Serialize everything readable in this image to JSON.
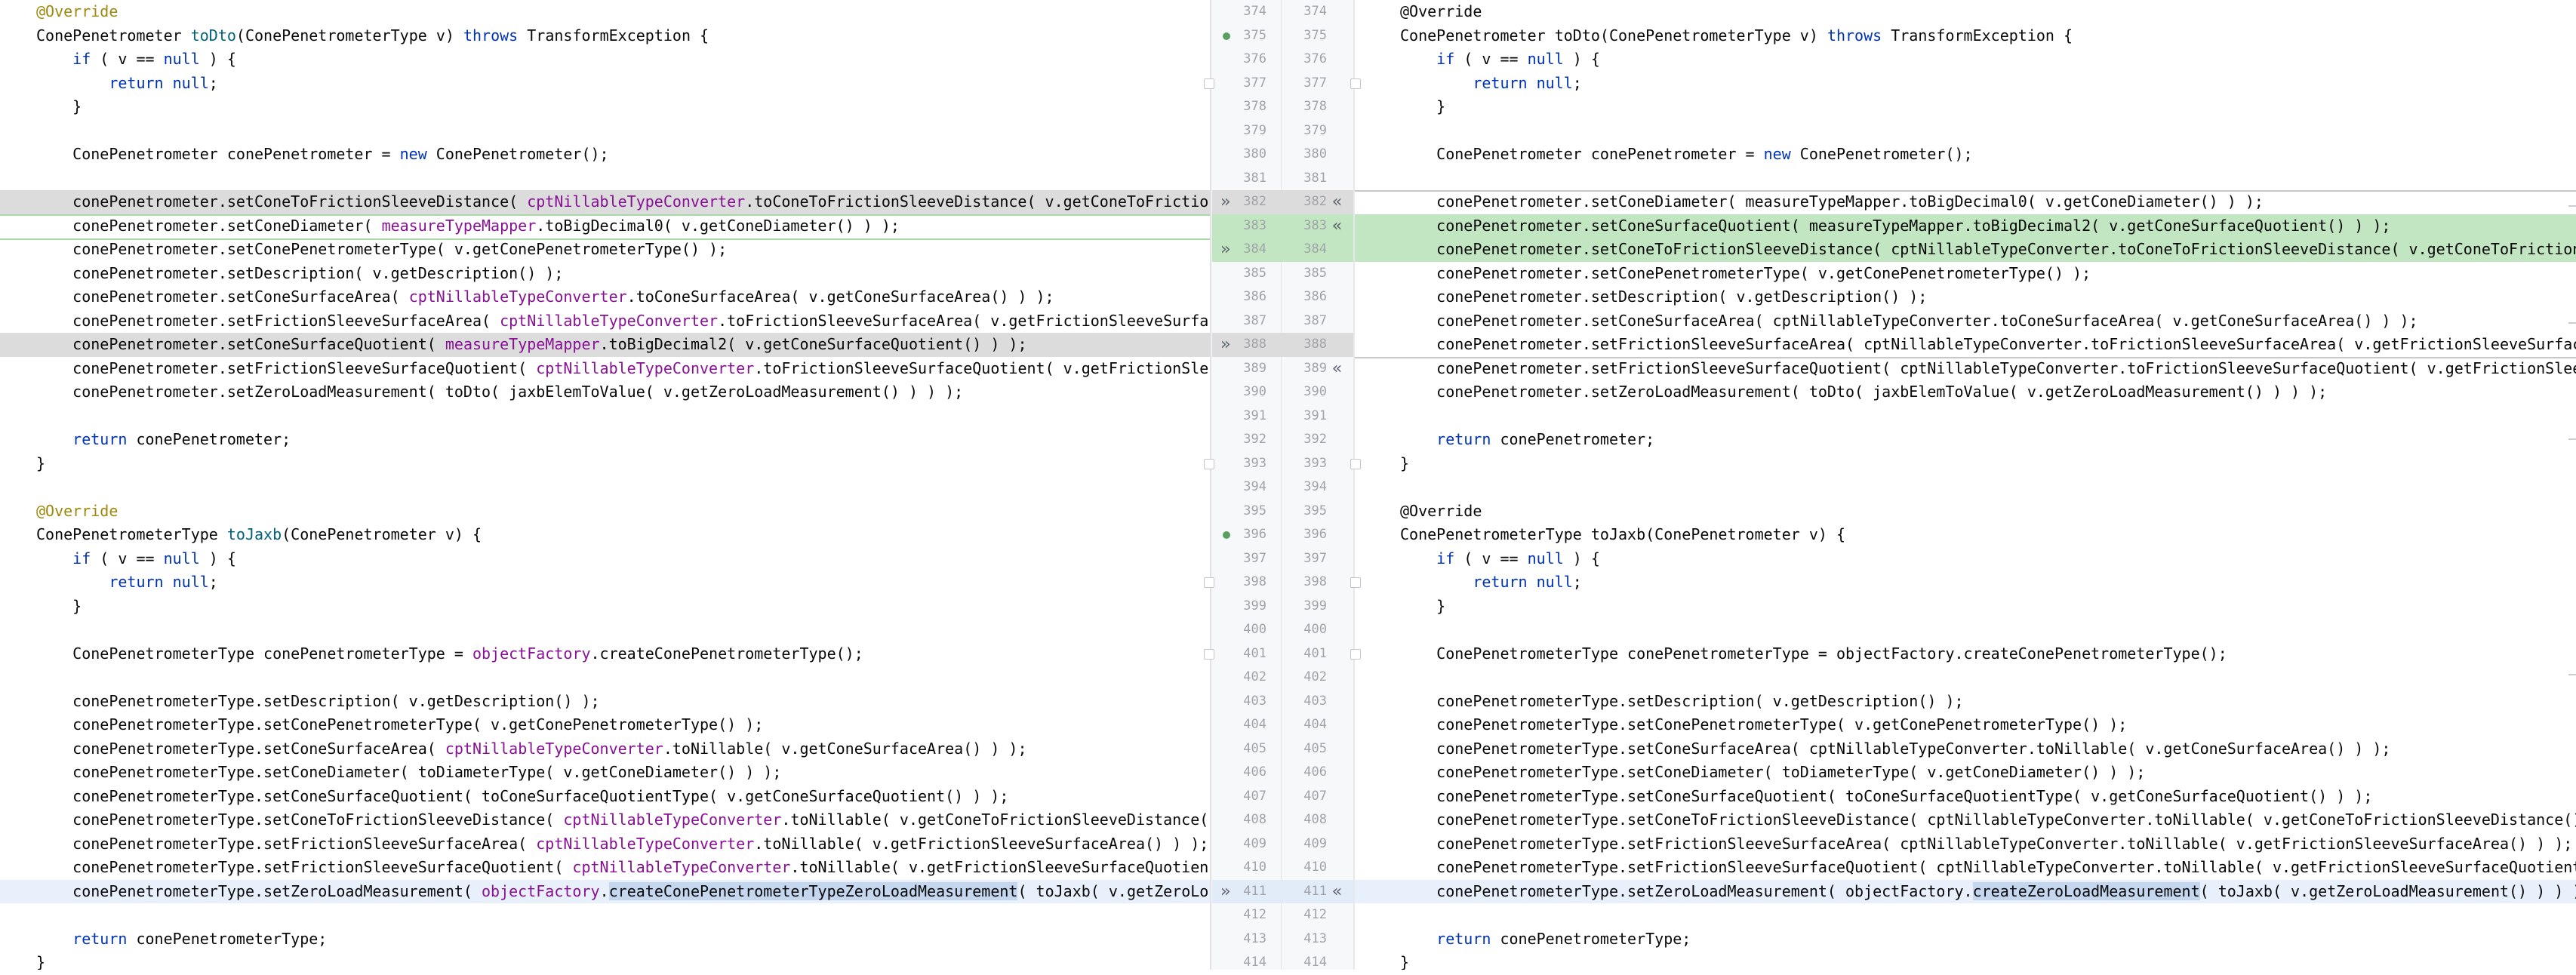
{
  "gutter": {
    "left_numbers": [
      "374",
      "375",
      "376",
      "377",
      "378",
      "379",
      "380",
      "381",
      "382",
      "383",
      "384",
      "385",
      "386",
      "387",
      "388",
      "389",
      "390",
      "391",
      "392",
      "393",
      "394",
      "395",
      "396",
      "397",
      "398",
      "399",
      "400",
      "401",
      "402",
      "403",
      "404",
      "405",
      "406",
      "407",
      "408",
      "409",
      "410",
      "411",
      "412",
      "413",
      "414"
    ],
    "right_numbers": [
      "374",
      "375",
      "376",
      "377",
      "378",
      "379",
      "380",
      "381",
      "382",
      "383",
      "384",
      "385",
      "386",
      "387",
      "388",
      "389",
      "390",
      "391",
      "392",
      "393",
      "394",
      "395",
      "396",
      "397",
      "398",
      "399",
      "400",
      "401",
      "402",
      "403",
      "404",
      "405",
      "406",
      "407",
      "408",
      "409",
      "410",
      "411",
      "412",
      "413",
      "414"
    ],
    "apply_right_glyph": "»",
    "apply_left_glyph": "«"
  },
  "colors": {
    "modified_gray": "#dcdcdc",
    "inserted_green": "#c2e6c1",
    "current_line_blue": "#e8f0fb",
    "selection": "#c4d7ef",
    "keyword": "#0033b3",
    "annotation": "#9e880d",
    "method_decl": "#00627a",
    "field": "#871094"
  },
  "left": {
    "lines": [
      [
        {
          "t": "@Override",
          "c": "an"
        }
      ],
      [
        {
          "t": "ConePenetrometer "
        },
        {
          "t": "toDto",
          "c": "fn"
        },
        {
          "t": "(ConePenetrometerType v) "
        },
        {
          "t": "throws",
          "c": "kw"
        },
        {
          "t": " TransformException {"
        }
      ],
      [
        {
          "t": "    "
        },
        {
          "t": "if",
          "c": "kw"
        },
        {
          "t": " ( v == "
        },
        {
          "t": "null",
          "c": "kw"
        },
        {
          "t": " ) {"
        }
      ],
      [
        {
          "t": "        "
        },
        {
          "t": "return null",
          "c": "kw"
        },
        {
          "t": ";"
        }
      ],
      [
        {
          "t": "    }"
        }
      ],
      [],
      [
        {
          "t": "    ConePenetrometer conePenetrometer = "
        },
        {
          "t": "new",
          "c": "kw"
        },
        {
          "t": " ConePenetrometer();"
        }
      ],
      [],
      [
        {
          "t": "    conePenetrometer.setConeToFrictionSleeveDistance( "
        },
        {
          "t": "cptNillableTypeConverter",
          "c": "fld"
        },
        {
          "t": ".toConeToFrictionSleeveDistance( v.getConeToFrictio"
        }
      ],
      [
        {
          "t": "    conePenetrometer.setConeDiameter( "
        },
        {
          "t": "measureTypeMapper",
          "c": "fld"
        },
        {
          "t": ".toBigDecimal0( v.getConeDiameter() ) );"
        }
      ],
      [
        {
          "t": "    conePenetrometer.setConePenetrometerType( v.getConePenetrometerType() );"
        }
      ],
      [
        {
          "t": "    conePenetrometer.setDescription( v.getDescription() );"
        }
      ],
      [
        {
          "t": "    conePenetrometer.setConeSurfaceArea( "
        },
        {
          "t": "cptNillableTypeConverter",
          "c": "fld"
        },
        {
          "t": ".toConeSurfaceArea( v.getConeSurfaceArea() ) );"
        }
      ],
      [
        {
          "t": "    conePenetrometer.setFrictionSleeveSurfaceArea( "
        },
        {
          "t": "cptNillableTypeConverter",
          "c": "fld"
        },
        {
          "t": ".toFrictionSleeveSurfaceArea( v.getFrictionSleeveSurfa"
        }
      ],
      [
        {
          "t": "    conePenetrometer.setConeSurfaceQuotient( "
        },
        {
          "t": "measureTypeMapper",
          "c": "fld"
        },
        {
          "t": ".toBigDecimal2( v.getConeSurfaceQuotient() ) );"
        }
      ],
      [
        {
          "t": "    conePenetrometer.setFrictionSleeveSurfaceQuotient( "
        },
        {
          "t": "cptNillableTypeConverter",
          "c": "fld"
        },
        {
          "t": ".toFrictionSleeveSurfaceQuotient( v.getFrictionSle"
        }
      ],
      [
        {
          "t": "    conePenetrometer.setZeroLoadMeasurement( toDto( jaxbElemToValue( v.getZeroLoadMeasurement() ) ) );"
        }
      ],
      [],
      [
        {
          "t": "    "
        },
        {
          "t": "return",
          "c": "kw"
        },
        {
          "t": " conePenetrometer;"
        }
      ],
      [
        {
          "t": "}"
        }
      ],
      [],
      [
        {
          "t": "@Override",
          "c": "an"
        }
      ],
      [
        {
          "t": "ConePenetrometerType "
        },
        {
          "t": "toJaxb",
          "c": "fn"
        },
        {
          "t": "(ConePenetrometer v) {"
        }
      ],
      [
        {
          "t": "    "
        },
        {
          "t": "if",
          "c": "kw"
        },
        {
          "t": " ( v == "
        },
        {
          "t": "null",
          "c": "kw"
        },
        {
          "t": " ) {"
        }
      ],
      [
        {
          "t": "        "
        },
        {
          "t": "return null",
          "c": "kw"
        },
        {
          "t": ";"
        }
      ],
      [
        {
          "t": "    }"
        }
      ],
      [],
      [
        {
          "t": "    ConePenetrometerType conePenetrometerType = "
        },
        {
          "t": "objectFactory",
          "c": "fld"
        },
        {
          "t": ".createConePenetrometerType();"
        }
      ],
      [],
      [
        {
          "t": "    conePenetrometerType.setDescription( v.getDescription() );"
        }
      ],
      [
        {
          "t": "    conePenetrometerType.setConePenetrometerType( v.getConePenetrometerType() );"
        }
      ],
      [
        {
          "t": "    conePenetrometerType.setConeSurfaceArea( "
        },
        {
          "t": "cptNillableTypeConverter",
          "c": "fld"
        },
        {
          "t": ".toNillable( v.getConeSurfaceArea() ) );"
        }
      ],
      [
        {
          "t": "    conePenetrometerType.setConeDiameter( toDiameterType( v.getConeDiameter() ) );"
        }
      ],
      [
        {
          "t": "    conePenetrometerType.setConeSurfaceQuotient( toConeSurfaceQuotientType( v.getConeSurfaceQuotient() ) );"
        }
      ],
      [
        {
          "t": "    conePenetrometerType.setConeToFrictionSleeveDistance( "
        },
        {
          "t": "cptNillableTypeConverter",
          "c": "fld"
        },
        {
          "t": ".toNillable( v.getConeToFrictionSleeveDistance("
        }
      ],
      [
        {
          "t": "    conePenetrometerType.setFrictionSleeveSurfaceArea( "
        },
        {
          "t": "cptNillableTypeConverter",
          "c": "fld"
        },
        {
          "t": ".toNillable( v.getFrictionSleeveSurfaceArea() ) );"
        }
      ],
      [
        {
          "t": "    conePenetrometerType.setFrictionSleeveSurfaceQuotient( "
        },
        {
          "t": "cptNillableTypeConverter",
          "c": "fld"
        },
        {
          "t": ".toNillable( v.getFrictionSleeveSurfaceQuotien"
        }
      ],
      [
        {
          "t": "    conePenetrometerType.setZeroLoadMeasurement( "
        },
        {
          "t": "objectFactory",
          "c": "fld"
        },
        {
          "t": "."
        },
        {
          "t": "createConePenetrometerTypeZeroLoadMeasurement",
          "c": "hlsel"
        },
        {
          "t": "( toJaxb( v.getZeroLo"
        }
      ],
      [],
      [
        {
          "t": "    "
        },
        {
          "t": "return",
          "c": "kw"
        },
        {
          "t": " conePenetrometerType;"
        }
      ],
      [
        {
          "t": "}"
        }
      ]
    ]
  },
  "right": {
    "lines": [
      [
        {
          "t": "@Override"
        }
      ],
      [
        {
          "t": "ConePenetrometer toDto(ConePenetrometerType v) "
        },
        {
          "t": "throws",
          "c": "kw"
        },
        {
          "t": " TransformException {"
        }
      ],
      [
        {
          "t": "    "
        },
        {
          "t": "if",
          "c": "kw"
        },
        {
          "t": " ( v == "
        },
        {
          "t": "null",
          "c": "kw"
        },
        {
          "t": " ) {"
        }
      ],
      [
        {
          "t": "        "
        },
        {
          "t": "return null",
          "c": "kw"
        },
        {
          "t": ";"
        }
      ],
      [
        {
          "t": "    }"
        }
      ],
      [],
      [
        {
          "t": "    ConePenetrometer conePenetrometer = "
        },
        {
          "t": "new",
          "c": "kw"
        },
        {
          "t": " ConePenetrometer();"
        }
      ],
      [],
      [
        {
          "t": "    conePenetrometer.setConeDiameter( measureTypeMapper.toBigDecimal0( v.getConeDiameter() ) );"
        }
      ],
      [
        {
          "t": "    conePenetrometer.setConeSurfaceQuotient( measureTypeMapper.toBigDecimal2( v.getConeSurfaceQuotient() ) );"
        }
      ],
      [
        {
          "t": "    conePenetrometer.setConeToFrictionSleeveDistance( cptNillableTypeConverter.toConeToFrictionSleeveDistance( v.getConeToFriction"
        }
      ],
      [
        {
          "t": "    conePenetrometer.setConePenetrometerType( v.getConePenetrometerType() );"
        }
      ],
      [
        {
          "t": "    conePenetrometer.setDescription( v.getDescription() );"
        }
      ],
      [
        {
          "t": "    conePenetrometer.setConeSurfaceArea( cptNillableTypeConverter.toConeSurfaceArea( v.getConeSurfaceArea() ) );"
        }
      ],
      [
        {
          "t": "    conePenetrometer.setFrictionSleeveSurfaceArea( cptNillableTypeConverter.toFrictionSleeveSurfaceArea( v.getFrictionSleeveSurfac"
        }
      ],
      [
        {
          "t": "    conePenetrometer.setFrictionSleeveSurfaceQuotient( cptNillableTypeConverter.toFrictionSleeveSurfaceQuotient( v.getFrictionSlee"
        }
      ],
      [
        {
          "t": "    conePenetrometer.setZeroLoadMeasurement( toDto( jaxbElemToValue( v.getZeroLoadMeasurement() ) ) );"
        }
      ],
      [],
      [
        {
          "t": "    "
        },
        {
          "t": "return",
          "c": "kw"
        },
        {
          "t": " conePenetrometer;"
        }
      ],
      [
        {
          "t": "}"
        }
      ],
      [],
      [
        {
          "t": "@Override"
        }
      ],
      [
        {
          "t": "ConePenetrometerType toJaxb(ConePenetrometer v) {"
        }
      ],
      [
        {
          "t": "    "
        },
        {
          "t": "if",
          "c": "kw"
        },
        {
          "t": " ( v == "
        },
        {
          "t": "null",
          "c": "kw"
        },
        {
          "t": " ) {"
        }
      ],
      [
        {
          "t": "        "
        },
        {
          "t": "return null",
          "c": "kw"
        },
        {
          "t": ";"
        }
      ],
      [
        {
          "t": "    }"
        }
      ],
      [],
      [
        {
          "t": "    ConePenetrometerType conePenetrometerType = objectFactory.createConePenetrometerType();"
        }
      ],
      [],
      [
        {
          "t": "    conePenetrometerType.setDescription( v.getDescription() );"
        }
      ],
      [
        {
          "t": "    conePenetrometerType.setConePenetrometerType( v.getConePenetrometerType() );"
        }
      ],
      [
        {
          "t": "    conePenetrometerType.setConeSurfaceArea( cptNillableTypeConverter.toNillable( v.getConeSurfaceArea() ) );"
        }
      ],
      [
        {
          "t": "    conePenetrometerType.setConeDiameter( toDiameterType( v.getConeDiameter() ) );"
        }
      ],
      [
        {
          "t": "    conePenetrometerType.setConeSurfaceQuotient( toConeSurfaceQuotientType( v.getConeSurfaceQuotient() ) );"
        }
      ],
      [
        {
          "t": "    conePenetrometerType.setConeToFrictionSleeveDistance( cptNillableTypeConverter.toNillable( v.getConeToFrictionSleeveDistance()"
        }
      ],
      [
        {
          "t": "    conePenetrometerType.setFrictionSleeveSurfaceArea( cptNillableTypeConverter.toNillable( v.getFrictionSleeveSurfaceArea() ) );"
        }
      ],
      [
        {
          "t": "    conePenetrometerType.setFrictionSleeveSurfaceQuotient( cptNillableTypeConverter.toNillable( v.getFrictionSleeveSurfaceQuotient"
        }
      ],
      [
        {
          "t": "    conePenetrometerType.setZeroLoadMeasurement( objectFactory."
        },
        {
          "t": "createZeroLoadMeasurement",
          "c": "hlsel"
        },
        {
          "t": "( toJaxb( v.getZeroLoadMeasurement() ) ) );"
        }
      ],
      [],
      [
        {
          "t": "    "
        },
        {
          "t": "return",
          "c": "kw"
        },
        {
          "t": " conePenetrometerType;"
        }
      ],
      [
        {
          "t": "}"
        }
      ]
    ]
  }
}
